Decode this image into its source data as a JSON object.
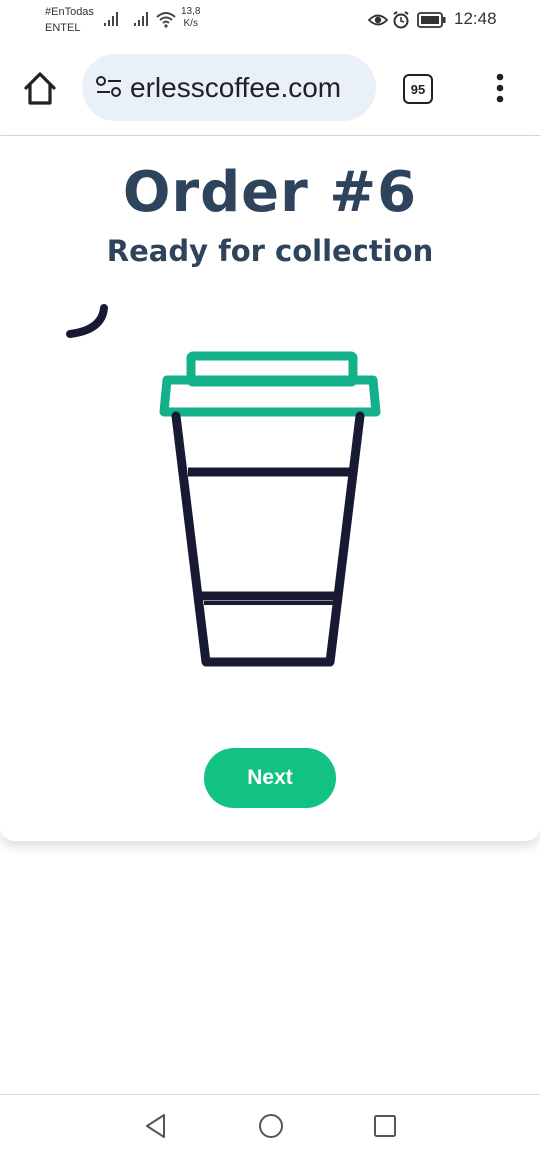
{
  "status_bar": {
    "carrier_line1": "#EnTodas",
    "carrier_line2": "ENTEL",
    "speed_value": "13,8",
    "speed_unit": "K/s",
    "time": "12:48"
  },
  "browser": {
    "url": "erlesscoffee.com",
    "tab_count": "95"
  },
  "order": {
    "title": "Order #6",
    "status": "Ready for collection",
    "next_label": "Next"
  },
  "colors": {
    "heading": "#2e445c",
    "accent_green": "#12c283",
    "lid_teal": "#14b08a",
    "cup_outline": "#181a34"
  }
}
